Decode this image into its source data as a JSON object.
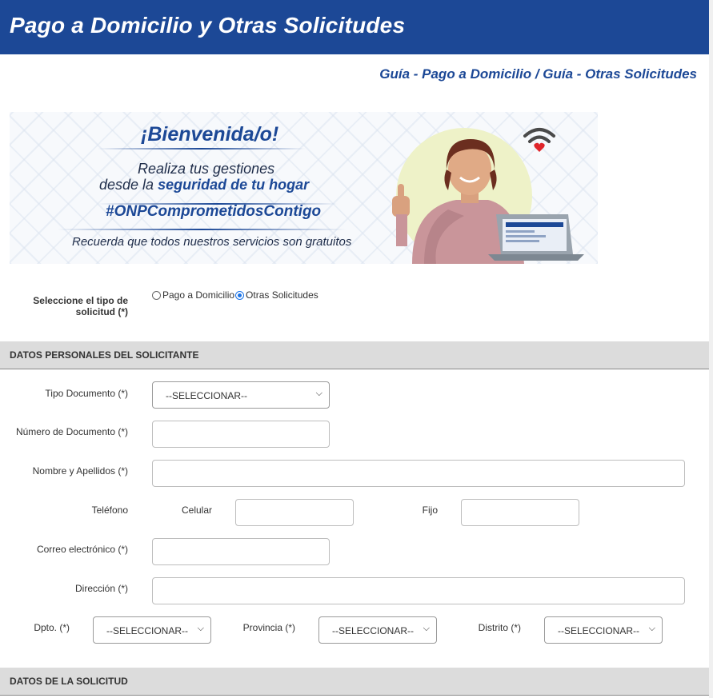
{
  "header": {
    "title": "Pago a Domicilio y Otras Solicitudes"
  },
  "guide": {
    "label": "Guía - Pago a Domicilio / Guía - Otras Solicitudes"
  },
  "banner": {
    "title": "¡Bienvenida/o!",
    "line1": "Realiza tus gestiones",
    "line2_prefix": "desde la ",
    "line2_bold": "seguridad de tu hogar",
    "hashtag": "#ONPComprometidosContigo",
    "note": "Recuerda que todos nuestros servicios son gratuitos"
  },
  "request_type": {
    "label_line1": "Seleccione el tipo de",
    "label_line2": "solicitud (*)",
    "options": [
      {
        "label": "Pago a Domicilio",
        "selected": false
      },
      {
        "label": "Otras Solicitudes",
        "selected": true
      }
    ]
  },
  "sections": {
    "personal": "DATOS PERSONALES DEL SOLICITANTE",
    "request": "DATOS DE LA SOLICITUD"
  },
  "form": {
    "doc_type_label": "Tipo Documento (*)",
    "doc_type_value": "--SELECCIONAR--",
    "doc_number_label": "Número de Documento (*)",
    "name_label": "Nombre y Apellidos (*)",
    "phone_label": "Teléfono",
    "mobile_label": "Celular",
    "landline_label": "Fijo",
    "email_label": "Correo electrónico (*)",
    "address_label": "Dirección (*)",
    "dept_label": "Dpto. (*)",
    "dept_value": "--SELECCIONAR--",
    "province_label": "Provincia (*)",
    "province_value": "--SELECCIONAR--",
    "district_label": "Distrito (*)",
    "district_value": "--SELECCIONAR--"
  },
  "colors": {
    "brand": "#1c4896",
    "section_bg": "#dcdcdc"
  },
  "icons": [
    "wifi-icon",
    "heart-icon",
    "chevron-down-icon"
  ]
}
